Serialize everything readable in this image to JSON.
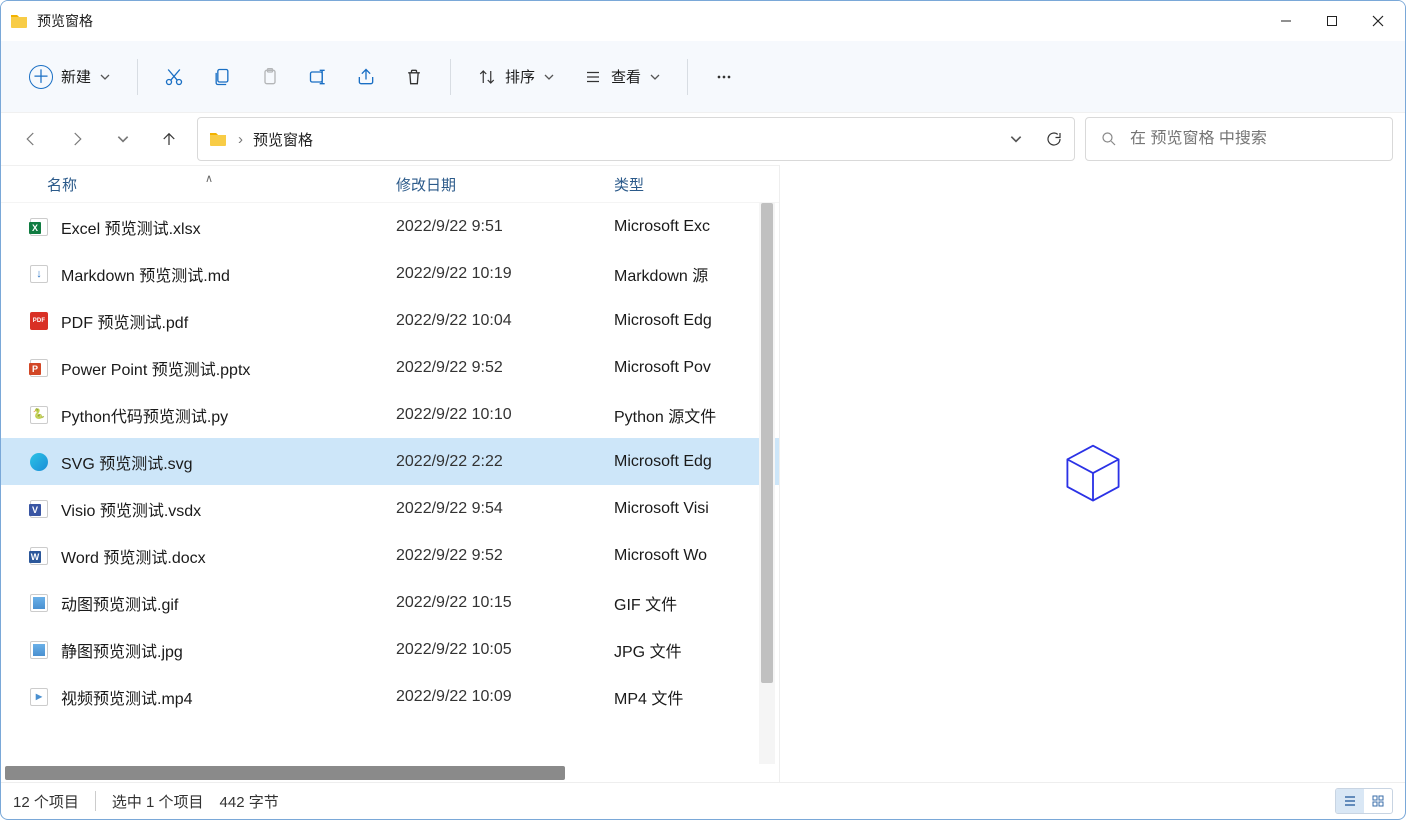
{
  "window": {
    "title": "预览窗格"
  },
  "toolbar": {
    "new_label": "新建",
    "sort_label": "排序",
    "view_label": "查看"
  },
  "address": {
    "folder": "预览窗格"
  },
  "search": {
    "placeholder": "在 预览窗格 中搜索"
  },
  "columns": {
    "name": "名称",
    "date": "修改日期",
    "type": "类型"
  },
  "files": [
    {
      "icon": "xlsx",
      "name": "Excel 预览测试.xlsx",
      "date": "2022/9/22 9:51",
      "type": "Microsoft Exc",
      "selected": false
    },
    {
      "icon": "md",
      "name": "Markdown 预览测试.md",
      "date": "2022/9/22 10:19",
      "type": "Markdown 源",
      "selected": false
    },
    {
      "icon": "pdf",
      "name": "PDF 预览测试.pdf",
      "date": "2022/9/22 10:04",
      "type": "Microsoft Edg",
      "selected": false
    },
    {
      "icon": "pptx",
      "name": "Power Point 预览测试.pptx",
      "date": "2022/9/22 9:52",
      "type": "Microsoft Pov",
      "selected": false
    },
    {
      "icon": "py",
      "name": "Python代码预览测试.py",
      "date": "2022/9/22 10:10",
      "type": "Python 源文件",
      "selected": false
    },
    {
      "icon": "svg",
      "name": "SVG 预览测试.svg",
      "date": "2022/9/22 2:22",
      "type": "Microsoft Edg",
      "selected": true
    },
    {
      "icon": "vsdx",
      "name": "Visio 预览测试.vsdx",
      "date": "2022/9/22 9:54",
      "type": "Microsoft Visi",
      "selected": false
    },
    {
      "icon": "docx",
      "name": "Word 预览测试.docx",
      "date": "2022/9/22 9:52",
      "type": "Microsoft Wo",
      "selected": false
    },
    {
      "icon": "gif",
      "name": "动图预览测试.gif",
      "date": "2022/9/22 10:15",
      "type": "GIF 文件",
      "selected": false
    },
    {
      "icon": "jpg",
      "name": "静图预览测试.jpg",
      "date": "2022/9/22 10:05",
      "type": "JPG 文件",
      "selected": false
    },
    {
      "icon": "mp4",
      "name": "视频预览测试.mp4",
      "date": "2022/9/22 10:09",
      "type": "MP4 文件",
      "selected": false
    }
  ],
  "status": {
    "items": "12 个项目",
    "selected": "选中 1 个项目",
    "size": "442 字节"
  }
}
